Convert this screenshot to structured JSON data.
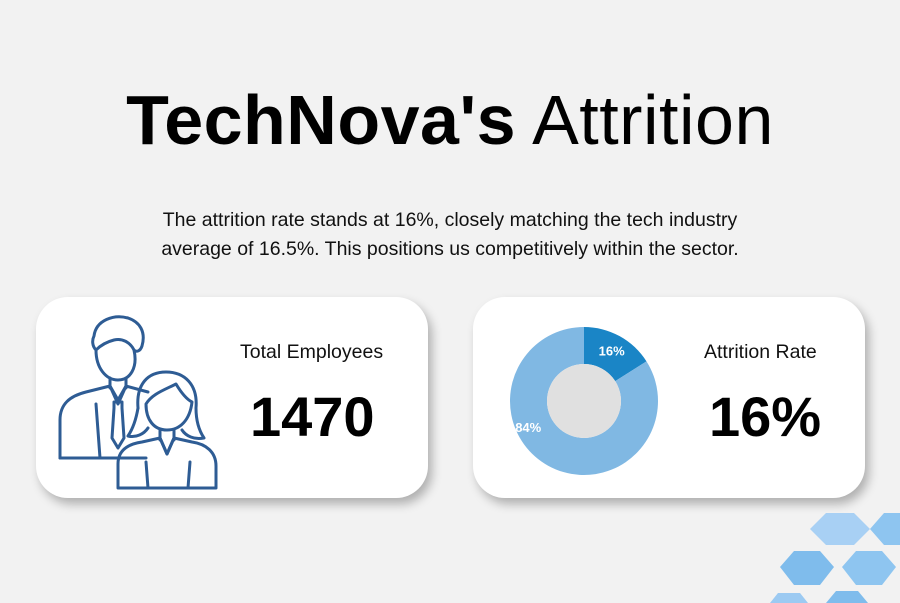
{
  "title": {
    "bold": "TechNova's",
    "light": "Attrition"
  },
  "subtitle": {
    "line1": "The attrition rate stands at 16%, closely matching the tech industry",
    "line2": "average of 16.5%. This positions us competitively within the sector."
  },
  "kpis": {
    "employees": {
      "label": "Total Employees",
      "value": "1470",
      "icon": "people-icon"
    },
    "attrition": {
      "label": "Attrition Rate",
      "value": "16%"
    }
  },
  "chart_data": {
    "type": "pie",
    "variant": "donut",
    "slices": [
      {
        "label": "16%",
        "value": 16,
        "color": "#1a85c6"
      },
      {
        "label": "84%",
        "value": 84,
        "color": "#80b8e3"
      }
    ],
    "hole_color": "#e0e0e0"
  },
  "colors": {
    "background": "#f2f2f2",
    "icon_blue": "#2e5c94",
    "hex_light": "#a8d0f4",
    "hex_mid": "#7fbcec"
  }
}
